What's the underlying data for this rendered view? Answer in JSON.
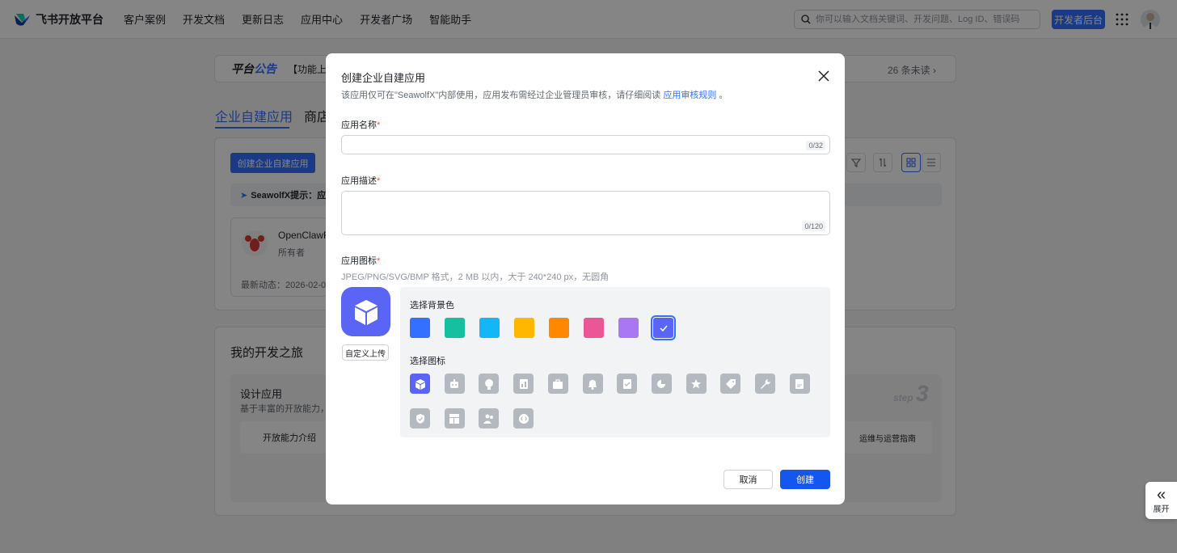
{
  "header": {
    "brand": "飞书开放平台",
    "nav": [
      "客户案例",
      "开发文档",
      "更新日志",
      "应用中心",
      "开发者广场",
      "智能助手"
    ],
    "search_placeholder": "你可以输入文档关键词、开发问题、Log ID、错误码",
    "console_button": "开发者后台"
  },
  "page": {
    "announce_title_a": "平台",
    "announce_title_b": "公告",
    "announce_text": "【功能上线",
    "unread": "26 条未读",
    "tab_custom": "企业自建应用",
    "tab_store": "商店",
    "create_button": "创建企业自建应用",
    "hint": "SeawolfX提示：应",
    "app_name": "OpenClawF",
    "app_owner": "所有者",
    "app_recent": "最新动态：2026-02-02",
    "journey_title": "我的开发之旅",
    "design_title": "设计应用",
    "design_desc": "基于丰富的开放能力，",
    "open_capability": "开放能力介绍",
    "ops_guide": "运维与运营指南",
    "step_label": "step",
    "step_number": "3",
    "expand": "展开"
  },
  "modal": {
    "title": "创建企业自建应用",
    "subtitle": "该应用仅可在\"SeawolfX\"内部使用，应用发布需经过企业管理员审核，请仔细阅读",
    "subtitle_link": "应用审核规则",
    "subtitle_end": "。",
    "name_label": "应用名称",
    "name_counter": "0/32",
    "desc_label": "应用描述",
    "desc_counter": "0/120",
    "icon_label": "应用图标",
    "required_mark": "*",
    "icon_hint": "JPEG/PNG/SVG/BMP 格式，2 MB 以内，大于 240*240 px，无圆角",
    "custom_upload": "自定义上传",
    "bg_label": "选择背景色",
    "icon_select_label": "选择图标",
    "bg_colors": [
      "#3370ff",
      "#14c0a0",
      "#14b6f5",
      "#ffb700",
      "#ff8800",
      "#eb5794",
      "#a976f4",
      "#5b65f5"
    ],
    "selected_bg_index": 7,
    "icons": [
      "cube-icon",
      "robot-icon",
      "lightbulb-icon",
      "report-icon",
      "briefcase-icon",
      "bell-icon",
      "checkmark-card-icon",
      "pie-chart-icon",
      "star-icon",
      "tag-icon",
      "wrench-icon",
      "document-icon",
      "shield-icon",
      "layout-icon",
      "people-icon",
      "code-icon"
    ],
    "selected_icon_index": 0,
    "cancel": "取消",
    "create": "创建"
  }
}
